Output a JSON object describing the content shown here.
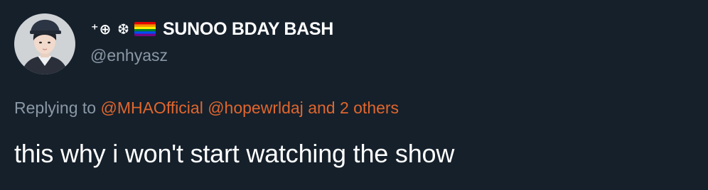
{
  "tweet": {
    "avatar_icon": "user-avatar-photo",
    "name_glyphs": "⁺⊕ ❆",
    "flag_icon": "rainbow-flag-icon",
    "display_name": "SUNOO BDAY BASH",
    "handle": "@enhyasz",
    "replying_prefix": "Replying to",
    "mention_1": "@MHAOfficial",
    "mention_2": "@hopewrldaj",
    "others": "and 2 others",
    "text": "this why i won't start watching the show"
  },
  "colors": {
    "background": "#15202b",
    "primary_text": "#ffffff",
    "secondary_text": "#8b98a5",
    "link": "#e0662d"
  }
}
